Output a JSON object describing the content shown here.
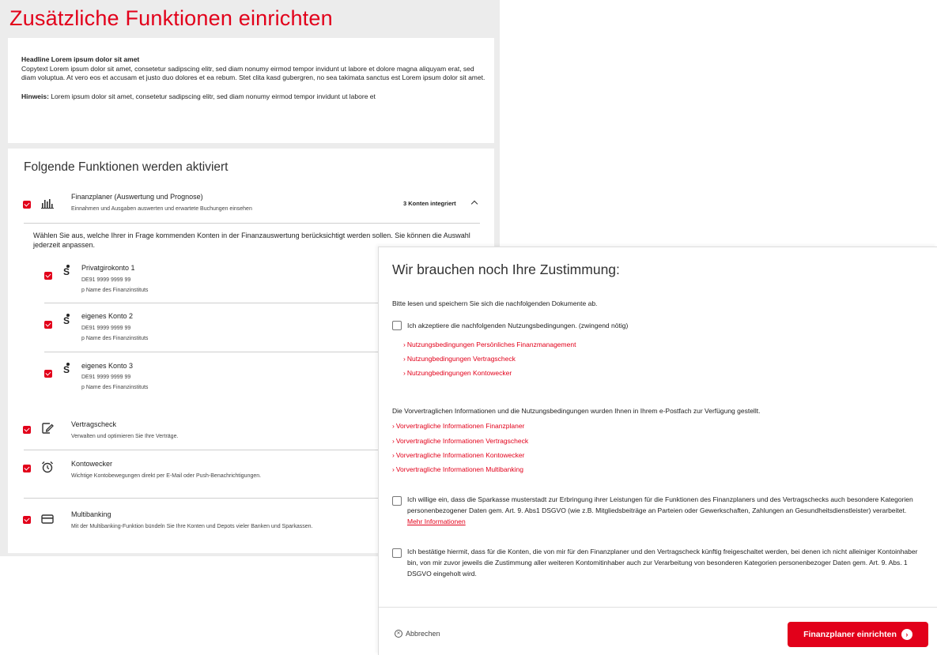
{
  "page": {
    "title": "Zusätzliche Funktionen einrichten"
  },
  "intro": {
    "headline": "Headline Lorem ipsum dolor sit amet",
    "copy": "Copytext Lorem ipsum dolor sit amet, consetetur sadipscing elitr, sed diam nonumy eirmod tempor invidunt ut labore et dolore magna aliquyam erat, sed diam voluptua. At vero eos et accusam et justo duo dolores et ea rebum. Stet clita kasd gubergren, no sea takimata sanctus est Lorem ipsum dolor sit amet.",
    "hint_label": "Hinweis:",
    "hint_text": " Lorem ipsum dolor sit amet, consetetur sadipscing elitr, sed diam nonumy eirmod tempor invidunt ut labore et"
  },
  "functions": {
    "title": "Folgende Funktionen werden aktiviert",
    "finanzplaner": {
      "title": "Finanzplaner (Auswertung und Prognose)",
      "subtitle": "Einnahmen und Ausgaben auswerten und erwartete Buchungen einsehen",
      "status": "3 Konten integriert",
      "select_text": "Wählen Sie aus, welche Ihrer in Frage kommenden Konten in der Finanzauswertung berücksichtigt werden sollen. Sie können die Auswahl jederzeit anpassen.",
      "accounts": [
        {
          "name": "Privatgirokonto 1",
          "iban": "DE91 9999 9999 99",
          "bank": "p Name des Finanzinstituts"
        },
        {
          "name": "eigenes Konto 2",
          "iban": "DE91 9999 9999 99",
          "bank": "p Name des Finanzinstituts"
        },
        {
          "name": "eigenes Konto 3",
          "iban": "DE91 9999 9999 99",
          "bank": "p Name des Finanzinstituts"
        }
      ]
    },
    "vertragscheck": {
      "title": "Vertragscheck",
      "subtitle": "Verwalten und optimieren Sie Ihre Verträge."
    },
    "kontowecker": {
      "title": "Kontowecker",
      "subtitle": "Wichtige Kontobewegungen direkt per E-Mail oder Push-Benachrichtigungen."
    },
    "multibanking": {
      "title": "Multibanking",
      "subtitle": "Mit der Multibanking-Funktion bündeln Sie Ihre Konten und Depots vieler Banken und Sparkassen."
    }
  },
  "consent": {
    "title": "Wir brauchen noch Ihre Zustimmung:",
    "intro": "Bitte lesen und speichern Sie sich die nachfolgenden Dokumente ab.",
    "terms_checkbox": "Ich akzeptiere die nachfolgenden Nutzungsbedingungen. (zwingend nötig)",
    "terms_links": [
      "Nutzungsbedingungen Persönliches Finanzmanagement",
      "Nutzungbedingungen Vertragscheck",
      "Nutzungbedingungen Kontowecker"
    ],
    "precontract_text": "Die Vorvertraglichen Informationen und die Nutzungsbedingungen wurden Ihnen in Ihrem e-Postfach zur Verfügung gestellt.",
    "precontract_links": [
      "Vorvertragliche Informationen Finanzplaner",
      "Vorvertragliche Informationen Vertragscheck",
      "Vorvertragliche Informationen Kontowecker",
      "Vorvertragliche Informationen Multibanking"
    ],
    "dsgvo_checkbox": "Ich willige ein, dass die Sparkasse musterstadt zur Erbringung ihrer Leistungen für die Funktionen des Finanzplaners und des Vertragschecks auch besondere Kategorien personenbezogener Daten gem. Art. 9. Abs1 DSGVO (wie z.B. Mitgliedsbeiträge an Parteien oder Gewerkschaften, Zahlungen an Gesundheitsdienstleister) verarbeitet. ",
    "more_info": "Mehr Informationen",
    "owners_checkbox": "Ich bestätige hiermit, dass für die Konten, die von mir für den Finanzplaner und den Vertragscheck künftig freigeschaltet werden, bei denen ich nicht alleiniger Kontoinhaber bin, von mir zuvor jeweils die Zustimmung aller weiteren Kontomitinhaber auch zur Verarbeitung von besonderen Kategorien personenbezoger Daten gem. Art. 9. Abs. 1 DSGVO eingeholt wird.",
    "cancel_label": "Abbrechen",
    "submit_label": "Finanzplaner einrichten"
  }
}
